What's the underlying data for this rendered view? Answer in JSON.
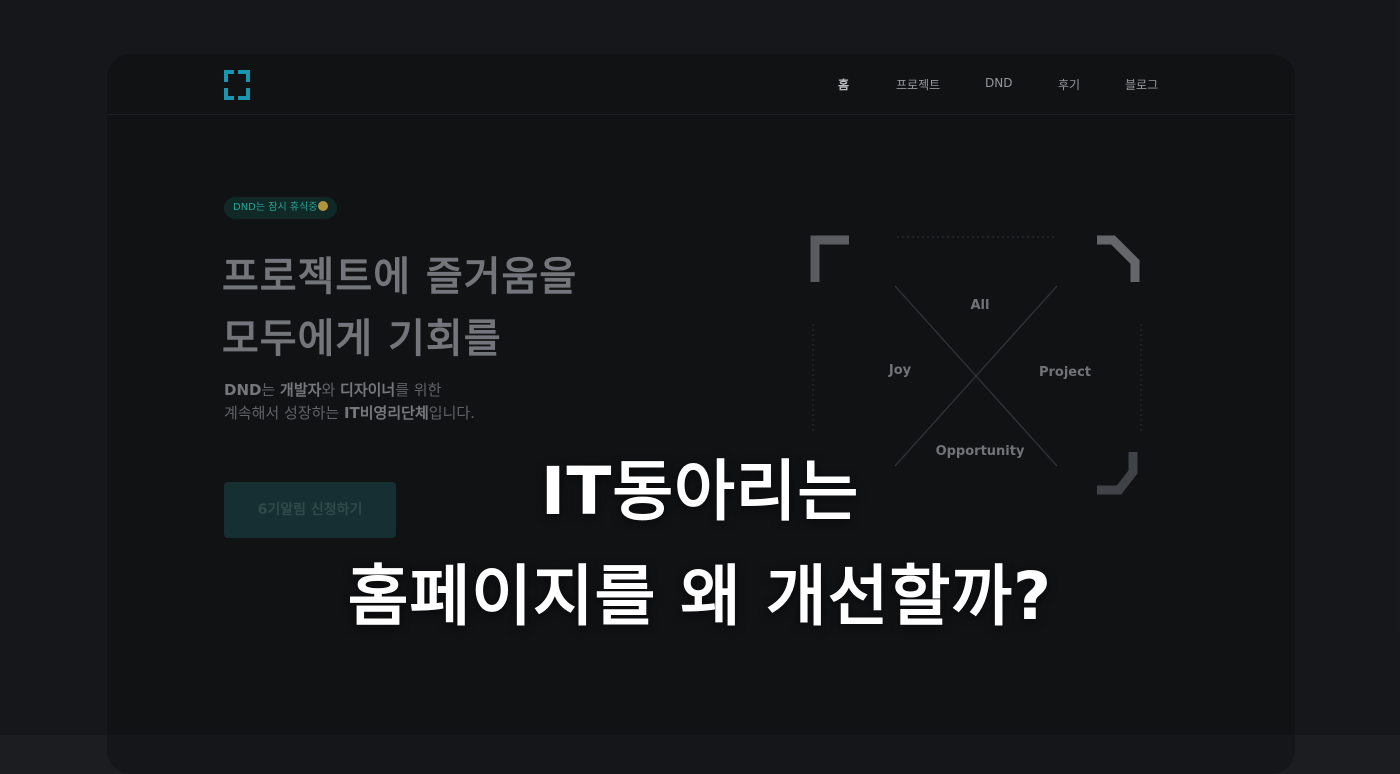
{
  "nav": {
    "logo_icon": "bracket-logo-icon",
    "items": [
      {
        "label": "홈",
        "active": true
      },
      {
        "label": "프로젝트",
        "active": false
      },
      {
        "label": "DND",
        "active": false
      },
      {
        "label": "후기",
        "active": false
      },
      {
        "label": "블로그",
        "active": false
      }
    ]
  },
  "hero": {
    "badge_text": "DND는 잠시 휴식중",
    "badge_emoji": "sleeping-face-emoji",
    "title_line1": "프로젝트에 즐거움을",
    "title_line2": "모두에게 기회를",
    "desc1": {
      "p1": "DND",
      "p2": "는 ",
      "p3": "개발자",
      "p4": "와 ",
      "p5": "디자이너",
      "p6": "를 위한"
    },
    "desc2": {
      "p1": "계속해서 성장하는 ",
      "p2": "IT비영리단체",
      "p3": "입니다."
    },
    "cta_label": "6기알림 신청하기"
  },
  "diagram": {
    "top": "All",
    "left": "Joy",
    "right": "Project",
    "bottom": "Opportunity"
  },
  "caption": {
    "line1": "IT동아리는",
    "line2": "홈페이지를 왜 개선할까?"
  },
  "colors": {
    "accent": "#2dc9b8",
    "logo": "#1fb7d6",
    "background": "#151619"
  }
}
